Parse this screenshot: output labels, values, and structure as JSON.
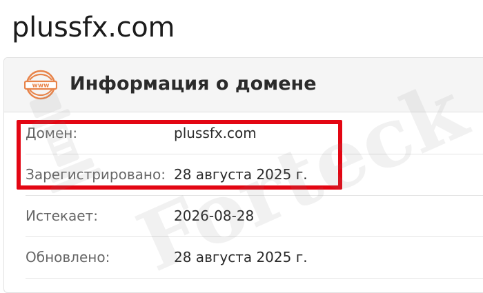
{
  "page": {
    "title": "plussfx.com"
  },
  "card": {
    "title": "Информация о домене",
    "icon": "www-icon",
    "icon_text": "www",
    "rows": [
      {
        "label": "Домен:",
        "value": "plussfx.com"
      },
      {
        "label": "Зарегистрировано:",
        "value": "28 августа 2025 г."
      },
      {
        "label": "Истекает:",
        "value": "2026-08-28"
      },
      {
        "label": "Обновлено:",
        "value": "28 августа 2025 г."
      }
    ]
  },
  "watermark": {
    "text": "Forteck"
  },
  "colors": {
    "accent_orange": "#e8844a",
    "highlight_red": "#e30613",
    "header_bg": "#f5f5f5"
  }
}
